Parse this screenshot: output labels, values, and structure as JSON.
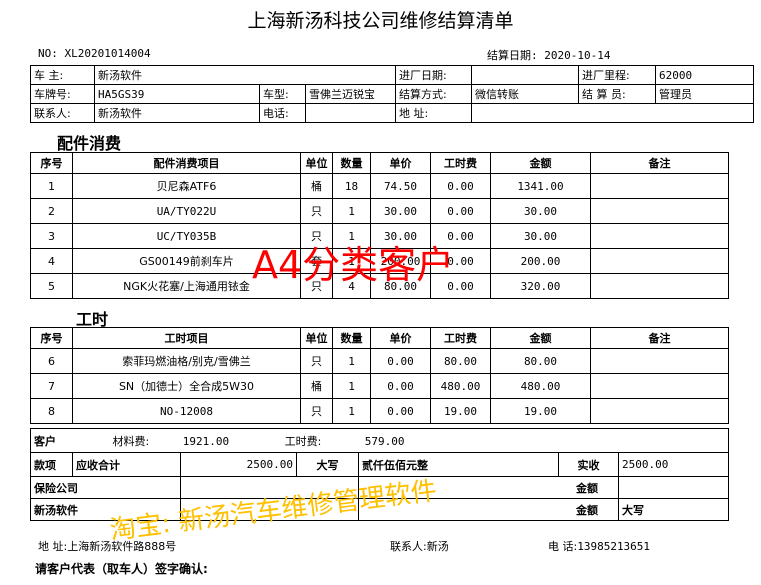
{
  "title": "上海新汤科技公司维修结算清单",
  "doc_no_label": "NO:",
  "doc_no": "XL20201014004",
  "settle_date_label": "结算日期:",
  "settle_date": "2020-10-14",
  "info": {
    "owner_label": "车   主:",
    "owner": "新汤软件",
    "in_date_label": "进厂日期:",
    "in_date": "",
    "mileage_label": "进厂里程:",
    "mileage": "62000",
    "plate_label": "车牌号:",
    "plate": "HA5GS39",
    "model_label": "车型:",
    "model": "雪佛兰迈锐宝",
    "pay_method_label": "结算方式:",
    "pay_method": "微信转账",
    "clerk_label": "结 算 员:",
    "clerk": "管理员",
    "contact_label": "联系人:",
    "contact": "新汤软件",
    "phone_label": "电话:",
    "phone": "",
    "address_label": "地    址:",
    "address": ""
  },
  "parts": {
    "section_title": "配件消费",
    "headers": [
      "序号",
      "配件消费项目",
      "单位",
      "数量",
      "单价",
      "工时费",
      "金额",
      "备注"
    ],
    "rows": [
      {
        "no": "1",
        "item": "贝尼森ATF6",
        "unit": "桶",
        "qty": "18",
        "price": "74.50",
        "labor": "0.00",
        "amount": "1341.00",
        "note": ""
      },
      {
        "no": "2",
        "item": "UA/TY022U",
        "unit": "只",
        "qty": "1",
        "price": "30.00",
        "labor": "0.00",
        "amount": "30.00",
        "note": ""
      },
      {
        "no": "3",
        "item": "UC/TY035B",
        "unit": "只",
        "qty": "1",
        "price": "30.00",
        "labor": "0.00",
        "amount": "30.00",
        "note": ""
      },
      {
        "no": "4",
        "item": "GS00149前刹车片",
        "unit": "套",
        "qty": "1",
        "price": "200.00",
        "labor": "0.00",
        "amount": "200.00",
        "note": ""
      },
      {
        "no": "5",
        "item": "NGK火花塞/上海通用铱金",
        "unit": "只",
        "qty": "4",
        "price": "80.00",
        "labor": "0.00",
        "amount": "320.00",
        "note": ""
      }
    ]
  },
  "labor": {
    "section_title": "工时",
    "headers": [
      "序号",
      "工时项目",
      "单位",
      "数量",
      "单价",
      "工时费",
      "金额",
      "备注"
    ],
    "rows": [
      {
        "no": "6",
        "item": "索菲玛燃油格/别克/雪佛兰",
        "unit": "只",
        "qty": "1",
        "price": "0.00",
        "labor": "80.00",
        "amount": "80.00",
        "note": ""
      },
      {
        "no": "7",
        "item": "SN（加德士）全合成5W30",
        "unit": "桶",
        "qty": "1",
        "price": "0.00",
        "labor": "480.00",
        "amount": "480.00",
        "note": ""
      },
      {
        "no": "8",
        "item": "NO-12008",
        "unit": "只",
        "qty": "1",
        "price": "0.00",
        "labor": "19.00",
        "amount": "19.00",
        "note": ""
      }
    ]
  },
  "summary": {
    "customer_label": "客户",
    "payment_label": "款项",
    "material_label": "材料费:",
    "material": "1921.00",
    "labor_fee_label": "工时费:",
    "labor_fee": "579.00",
    "receivable_label": "应收合计",
    "receivable": "2500.00",
    "daxie_label": "大写",
    "daxie": "贰仟伍佰元整",
    "received_label": "实收",
    "received": "2500.00",
    "insurance_label": "保险公司",
    "amount_label": "金额",
    "xintang_label": "新汤软件",
    "daxie_label2": "大写"
  },
  "footer": {
    "address_label": "地    址:",
    "address": "上海新汤软件路888号",
    "contact_label": "联系人:",
    "contact": "新汤",
    "phone_label": "电    话:",
    "phone": "13985213651",
    "sign_label": "请客户代表（取车人）签字确认:"
  },
  "watermarks": {
    "red": "A4分类客户",
    "yellow": "淘宝: 新汤汽车维修管理软件"
  },
  "colors": {
    "red_watermark": "#ff0000",
    "yellow_watermark": "#ffc000"
  }
}
